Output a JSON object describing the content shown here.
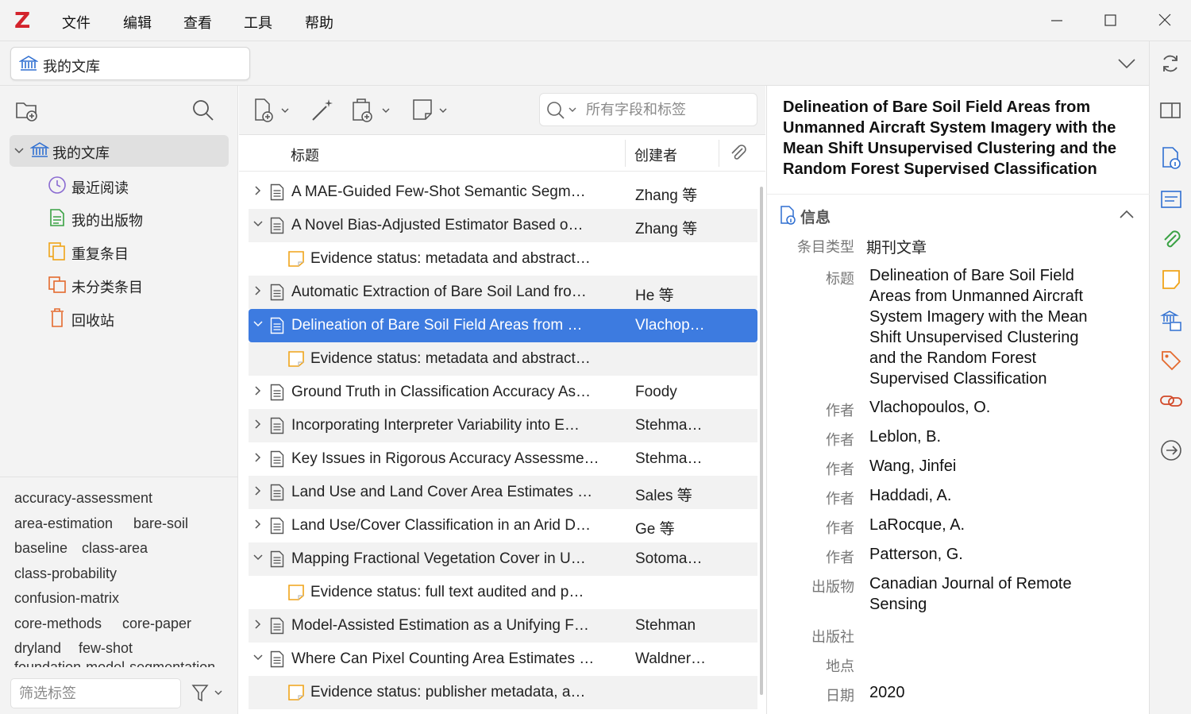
{
  "menubar": {
    "logo": "Z",
    "items": [
      "文件",
      "编辑",
      "查看",
      "工具",
      "帮助"
    ]
  },
  "tab": {
    "label": "我的文库"
  },
  "collections": {
    "root": "我的文库",
    "items": [
      "最近阅读",
      "我的出版物",
      "重复条目",
      "未分类条目",
      "回收站"
    ]
  },
  "tags": {
    "items": [
      "accuracy-assessment",
      "area-estimation",
      "bare-soil",
      "baseline",
      "class-area",
      "class-probability",
      "confusion-matrix",
      "core-methods",
      "core-paper",
      "dryland",
      "few-shot",
      "foundation-model-segmentation"
    ],
    "filter_placeholder": "筛选标签"
  },
  "search": {
    "placeholder": "所有字段和标签"
  },
  "columns": {
    "title": "标题",
    "creator": "创建者"
  },
  "rows": [
    {
      "title": "A MAE-Guided Few-Shot Semantic Segm…",
      "creator": "Zhang 等"
    },
    {
      "title": "A Novel Bias-Adjusted Estimator Based o…",
      "creator": "Zhang 等"
    },
    {
      "title": "Evidence status: metadata and abstract…",
      "creator": ""
    },
    {
      "title": "Automatic Extraction of Bare Soil Land fro…",
      "creator": "He 等"
    },
    {
      "title": "Delineation of Bare Soil Field Areas from …",
      "creator": "Vlachop…"
    },
    {
      "title": "Evidence status: metadata and abstract…",
      "creator": ""
    },
    {
      "title": "Ground Truth in Classification Accuracy As…",
      "creator": "Foody"
    },
    {
      "title": "Incorporating Interpreter Variability into E…",
      "creator": "Stehma…"
    },
    {
      "title": "Key Issues in Rigorous Accuracy Assessme…",
      "creator": "Stehma…"
    },
    {
      "title": "Land Use and Land Cover Area Estimates …",
      "creator": "Sales 等"
    },
    {
      "title": "Land Use/Cover Classification in an Arid D…",
      "creator": "Ge 等"
    },
    {
      "title": "Mapping Fractional Vegetation Cover in U…",
      "creator": "Sotoma…"
    },
    {
      "title": "Evidence status: full text audited and p…",
      "creator": ""
    },
    {
      "title": "Model-Assisted Estimation as a Unifying F…",
      "creator": "Stehman"
    },
    {
      "title": "Where Can Pixel Counting Area Estimates …",
      "creator": "Waldner…"
    },
    {
      "title": "Evidence status: publisher metadata, a…",
      "creator": ""
    }
  ],
  "item": {
    "header_title": "Delineation of Bare Soil Field Areas from Unmanned Aircraft System Imagery with the Mean Shift Unsupervised Clustering and the Random Forest Supervised Classification",
    "section": "信息",
    "labels": {
      "type": "条目类型",
      "title": "标题",
      "author": "作者",
      "publication": "出版物",
      "publisher": "出版社",
      "place": "地点",
      "date": "日期"
    },
    "type": "期刊文章",
    "title": "Delineation of Bare Soil Field Areas from Unmanned Aircraft System Imagery with the Mean Shift Unsupervised Clustering and the Random Forest Supervised Classification",
    "authors": [
      "Vlachopoulos, O.",
      "Leblon, B.",
      "Wang, Jinfei",
      "Haddadi, A.",
      "LaRocque, A.",
      "Patterson, G."
    ],
    "publication": "Canadian Journal of Remote Sensing",
    "publisher": "",
    "place": "",
    "date": "2020"
  },
  "colors": {
    "accent": "#3d7be0",
    "logo": "#d3232c",
    "sidebar_icon": "#2f6fd1"
  }
}
